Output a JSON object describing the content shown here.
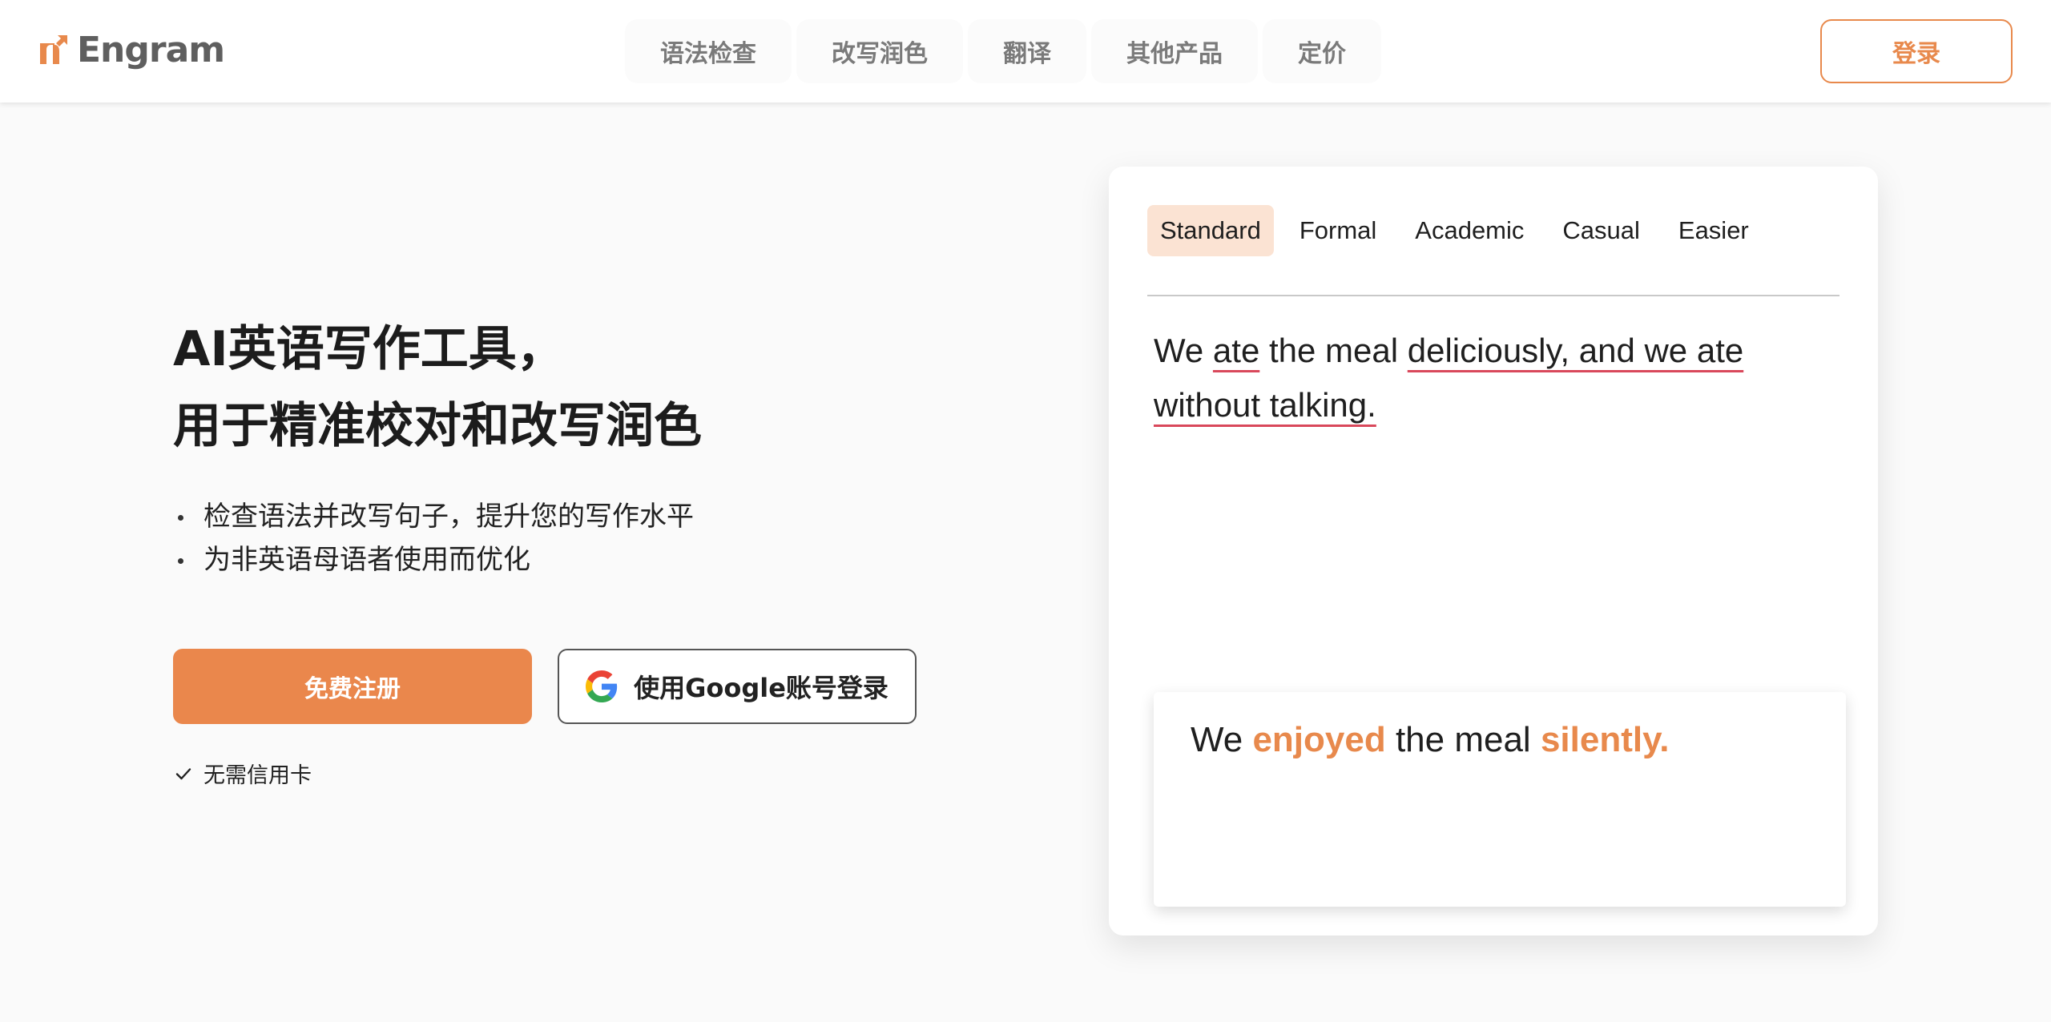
{
  "header": {
    "brand": "Engram",
    "brand_color": "#e8894c",
    "nav": [
      "语法检查",
      "改写润色",
      "翻译",
      "其他产品",
      "定价"
    ],
    "login_label": "登录"
  },
  "hero": {
    "title_lines": [
      "AI英语写作工具，",
      "用于精准校对和改写润色"
    ],
    "bullets": [
      "检查语法并改写句子，提升您的写作水平",
      "为非英语母语者使用而优化"
    ],
    "signup_label": "免费注册",
    "google_label": "使用Google账号登录",
    "no_card_label": "无需信用卡",
    "accent_color": "#ea874c"
  },
  "demo": {
    "tabs": [
      "Standard",
      "Formal",
      "Academic",
      "Casual",
      "Easier"
    ],
    "active_tab": "Standard",
    "source_segments": [
      {
        "text": "We ",
        "error": false
      },
      {
        "text": "ate",
        "error": true
      },
      {
        "text": " the meal ",
        "error": false
      },
      {
        "text": "deliciously, and we ate without talking.",
        "error": true
      }
    ],
    "result_segments": [
      {
        "text": "We ",
        "highlight": false
      },
      {
        "text": "enjoyed",
        "highlight": true
      },
      {
        "text": " the meal ",
        "highlight": false
      },
      {
        "text": "silently.",
        "highlight": true
      }
    ],
    "error_underline_color": "#d9485b",
    "highlight_color": "#e8894c"
  }
}
